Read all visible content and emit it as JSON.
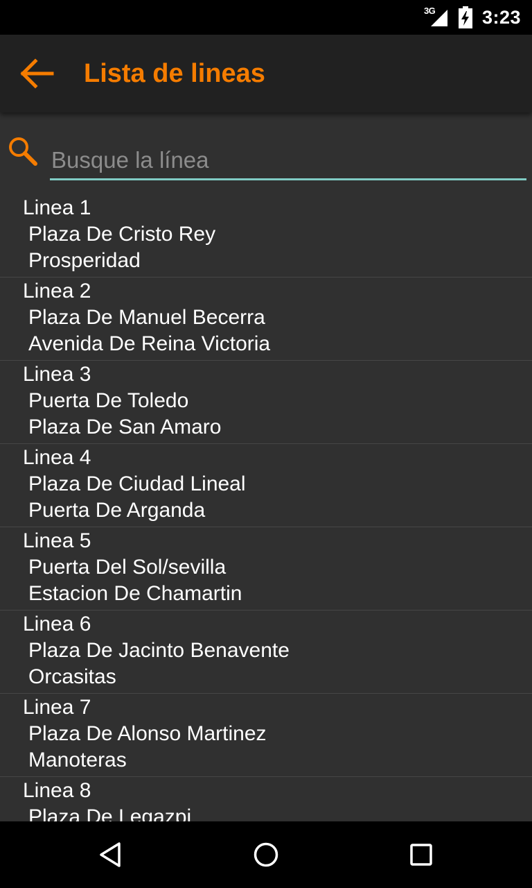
{
  "status_bar": {
    "network": "3G",
    "time": "3:23",
    "icons": [
      "signal-icon",
      "battery-charging-icon"
    ]
  },
  "app_bar": {
    "back_icon": "arrow-back-icon",
    "title": "Lista de lineas",
    "accent_color": "#f57c00"
  },
  "search": {
    "icon": "search-icon",
    "value": "",
    "placeholder": "Busque la línea",
    "underline_color": "#80cbc4"
  },
  "lines": [
    {
      "name": "Linea 1",
      "from": "Plaza De Cristo Rey",
      "to": "Prosperidad"
    },
    {
      "name": "Linea 2",
      "from": "Plaza De Manuel Becerra",
      "to": "Avenida De Reina Victoria"
    },
    {
      "name": "Linea 3",
      "from": "Puerta De Toledo",
      "to": "Plaza De San Amaro"
    },
    {
      "name": "Linea 4",
      "from": "Plaza De Ciudad Lineal",
      "to": "Puerta De Arganda"
    },
    {
      "name": "Linea 5",
      "from": "Puerta Del Sol/sevilla",
      "to": "Estacion De Chamartin"
    },
    {
      "name": "Linea 6",
      "from": "Plaza De Jacinto Benavente",
      "to": "Orcasitas"
    },
    {
      "name": "Linea 7",
      "from": "Plaza De Alonso Martinez",
      "to": "Manoteras"
    },
    {
      "name": "Linea 8",
      "from": "Plaza De Legazpi",
      "to": ""
    }
  ],
  "nav_bar": {
    "icons": [
      "back-triangle-icon",
      "home-circle-icon",
      "recents-square-icon"
    ]
  }
}
